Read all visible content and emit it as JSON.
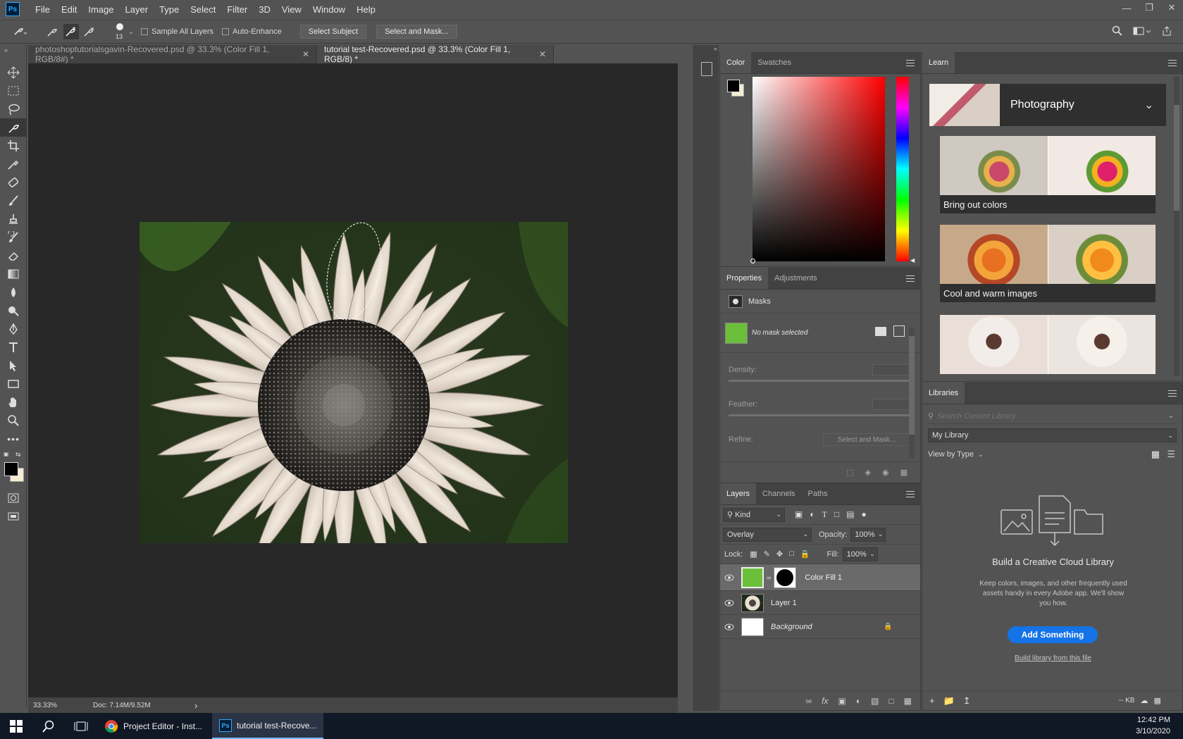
{
  "app": {
    "logo": "Ps"
  },
  "menu": [
    "File",
    "Edit",
    "Image",
    "Layer",
    "Type",
    "Select",
    "Filter",
    "3D",
    "View",
    "Window",
    "Help"
  ],
  "options_bar": {
    "brush_size": "13",
    "sample_all_layers": "Sample All Layers",
    "auto_enhance": "Auto-Enhance",
    "select_subject": "Select Subject",
    "select_and_mask": "Select and Mask..."
  },
  "documents": [
    {
      "title": "photoshoptutorialsgavin-Recovered.psd @ 33.3% (Color Fill 1, RGB/8#) *",
      "active": false
    },
    {
      "title": "tutorial test-Recovered.psd @ 33.3% (Color Fill 1, RGB/8) *",
      "active": true
    }
  ],
  "status": {
    "zoom": "33.33%",
    "doc": "Doc: 7.14M/9.52M",
    "arrow": "›"
  },
  "color_panel": {
    "tabs": [
      "Color",
      "Swatches"
    ],
    "foreground": "#000000",
    "background": "#f5ecd2"
  },
  "properties_panel": {
    "tabs": [
      "Properties",
      "Adjustments"
    ],
    "section": "Masks",
    "mask_status": "No mask selected",
    "density_label": "Density:",
    "feather_label": "Feather:",
    "refine_label": "Refine:",
    "select_and_mask": "Select and Mask..."
  },
  "layers_panel": {
    "tabs": [
      "Layers",
      "Channels",
      "Paths"
    ],
    "filter": "Kind",
    "blend_mode": "Overlay",
    "opacity_label": "Opacity:",
    "opacity": "100%",
    "lock_label": "Lock:",
    "fill_label": "Fill:",
    "fill": "100%",
    "layers": [
      {
        "name": "Color Fill 1",
        "selected": true,
        "italic": false
      },
      {
        "name": "Layer 1",
        "selected": false,
        "italic": false
      },
      {
        "name": "Background",
        "selected": false,
        "italic": true
      }
    ],
    "fill_color": "#6bbf3a"
  },
  "learn_panel": {
    "tab": "Learn",
    "topic": "Photography",
    "cards": [
      "Bring out colors",
      "Cool and warm images",
      ""
    ]
  },
  "libraries_panel": {
    "tab": "Libraries",
    "search_placeholder": "Search Current Library",
    "library": "My Library",
    "view_by": "View by Type",
    "heading": "Build a Creative Cloud Library",
    "description": "Keep colors, images, and other frequently used assets handy in every Adobe app. We'll show you how.",
    "cta": "Add Something",
    "link": "Build library from this file",
    "size": "-- KB",
    "cta_color": "#1473e6"
  },
  "taskbar": {
    "apps": [
      {
        "label": "Project Editor - Inst...",
        "active": false
      },
      {
        "label": "tutorial test-Recove...",
        "active": true
      }
    ],
    "time": "12:42 PM",
    "date": "3/10/2020"
  }
}
